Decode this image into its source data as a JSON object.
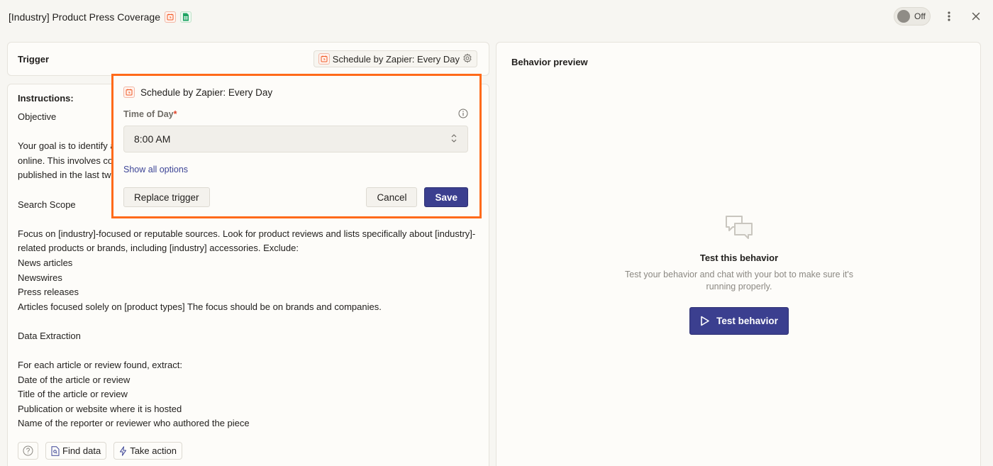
{
  "header": {
    "title": "[Industry] Product Press Coverage",
    "toggle_label": "Off",
    "toggle_state": "off"
  },
  "trigger": {
    "label": "Trigger",
    "chip_label": "Schedule by Zapier: Every Day"
  },
  "instructions": {
    "title": "Instructions:",
    "lines": [
      "Objective",
      "",
      "Your goal is to identify a",
      "online. This involves co",
      "published in the last two",
      "",
      "Search Scope",
      "",
      "Focus on [industry]-focused or reputable sources. Look for product reviews and lists specifically about [industry]-",
      "related products or brands, including [industry] accessories. Exclude:",
      "News articles",
      "Newswires",
      "Press releases",
      "Articles focused solely on [product types] The focus should be on brands and companies.",
      "",
      "Data Extraction",
      "",
      "For each article or review found, extract:",
      "Date of the article or review",
      "Title of the article or review",
      "Publication or website where it is hosted",
      "Name of the reporter or reviewer who authored the piece"
    ],
    "footer": {
      "find_data": "Find data",
      "take_action": "Take action"
    }
  },
  "popup": {
    "title": "Schedule by Zapier: Every Day",
    "field_label": "Time of Day",
    "required_mark": "*",
    "time_value": "8:00 AM",
    "show_all": "Show all options",
    "replace": "Replace trigger",
    "cancel": "Cancel",
    "save": "Save"
  },
  "preview": {
    "title": "Behavior preview",
    "empty_title": "Test this behavior",
    "empty_desc": "Test your behavior and chat with your bot to make sure it's running properly.",
    "test_button": "Test behavior"
  },
  "colors": {
    "accent": "#3b3f8f",
    "highlight": "#ff6a1a",
    "schedule_icon": "#f15a24",
    "sheets_icon": "#1fa463"
  }
}
